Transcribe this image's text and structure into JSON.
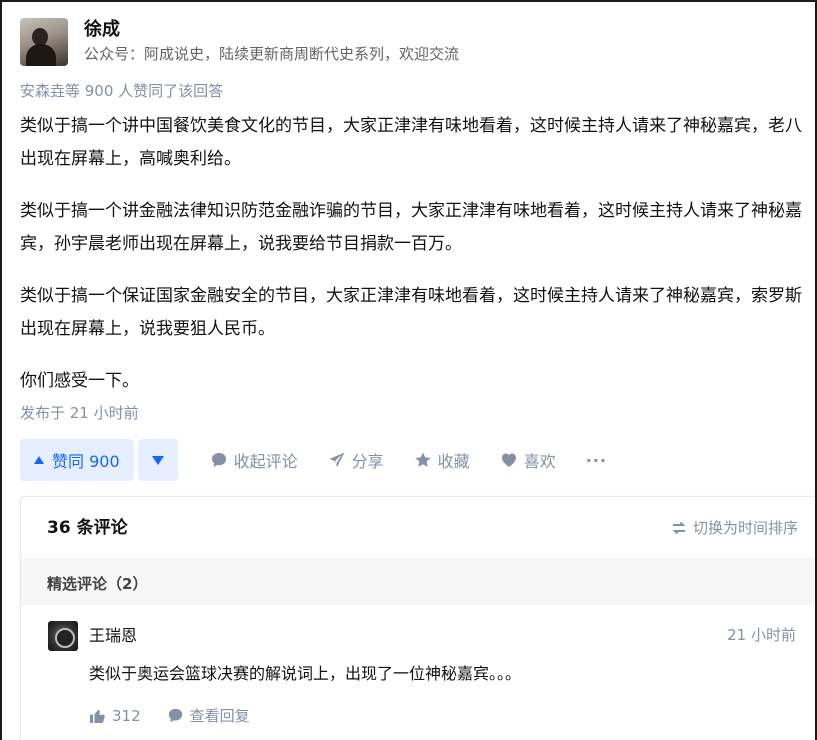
{
  "author": {
    "name": "徐成",
    "bio": "公众号：阿成说史，陆续更新商周断代史系列，欢迎交流"
  },
  "answer": {
    "upvoters_text": "安森垚等 900 人赞同了该回答",
    "paragraphs": [
      "类似于搞一个讲中国餐饮美食文化的节目，大家正津津有味地看着，这时候主持人请来了神秘嘉宾，老八出现在屏幕上，高喊奥利给。",
      "类似于搞一个讲金融法律知识防范金融诈骗的节目，大家正津津有味地看着，这时候主持人请来了神秘嘉宾，孙宇晨老师出现在屏幕上，说我要给节目捐款一百万。",
      "类似于搞一个保证国家金融安全的节目，大家正津津有味地看着，这时候主持人请来了神秘嘉宾，索罗斯出现在屏幕上，说我要狙人民币。",
      "你们感受一下。"
    ],
    "published": "发布于 21 小时前"
  },
  "actions": {
    "upvote": "赞同 900",
    "comment": "收起评论",
    "share": "分享",
    "favorite": "收藏",
    "like": "喜欢",
    "more": "···"
  },
  "comments": {
    "count_label": "36 条评论",
    "sort_label": "切换为时间排序",
    "featured_label": "精选评论（2）",
    "items": [
      {
        "author": "王瑞恩",
        "time": "21 小时前",
        "text": "类似于奥运会篮球决赛的解说词上，出现了一位神秘嘉宾。。。",
        "likes": "312",
        "reply_label": "查看回复"
      }
    ]
  },
  "colors": {
    "accent": "#1766ff",
    "accent_bg": "#e6efff",
    "meta": "#8590a6"
  }
}
